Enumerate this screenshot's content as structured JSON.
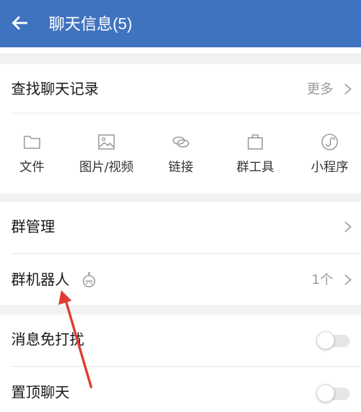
{
  "header": {
    "title": "聊天信息(5)",
    "bg_color": "#3f73c0",
    "back_icon": "arrow-left-icon"
  },
  "history": {
    "label": "查找聊天记录",
    "more_label": "更多"
  },
  "tools": [
    {
      "label": "文件",
      "icon": "folder-icon"
    },
    {
      "label": "图片/视频",
      "icon": "image-icon"
    },
    {
      "label": "链接",
      "icon": "link-icon"
    },
    {
      "label": "群工具",
      "icon": "briefcase-icon"
    },
    {
      "label": "小程序",
      "icon": "mini-program-icon"
    }
  ],
  "group": {
    "manage_label": "群管理",
    "robot_label": "群机器人",
    "robot_count": "1个",
    "robot_icon": "robot-icon"
  },
  "settings": {
    "mute_label": "消息免打扰",
    "mute_on": false,
    "pin_label": "置顶聊天",
    "pin_on": false
  },
  "annotation": {
    "arrow_color": "#e03c31"
  }
}
